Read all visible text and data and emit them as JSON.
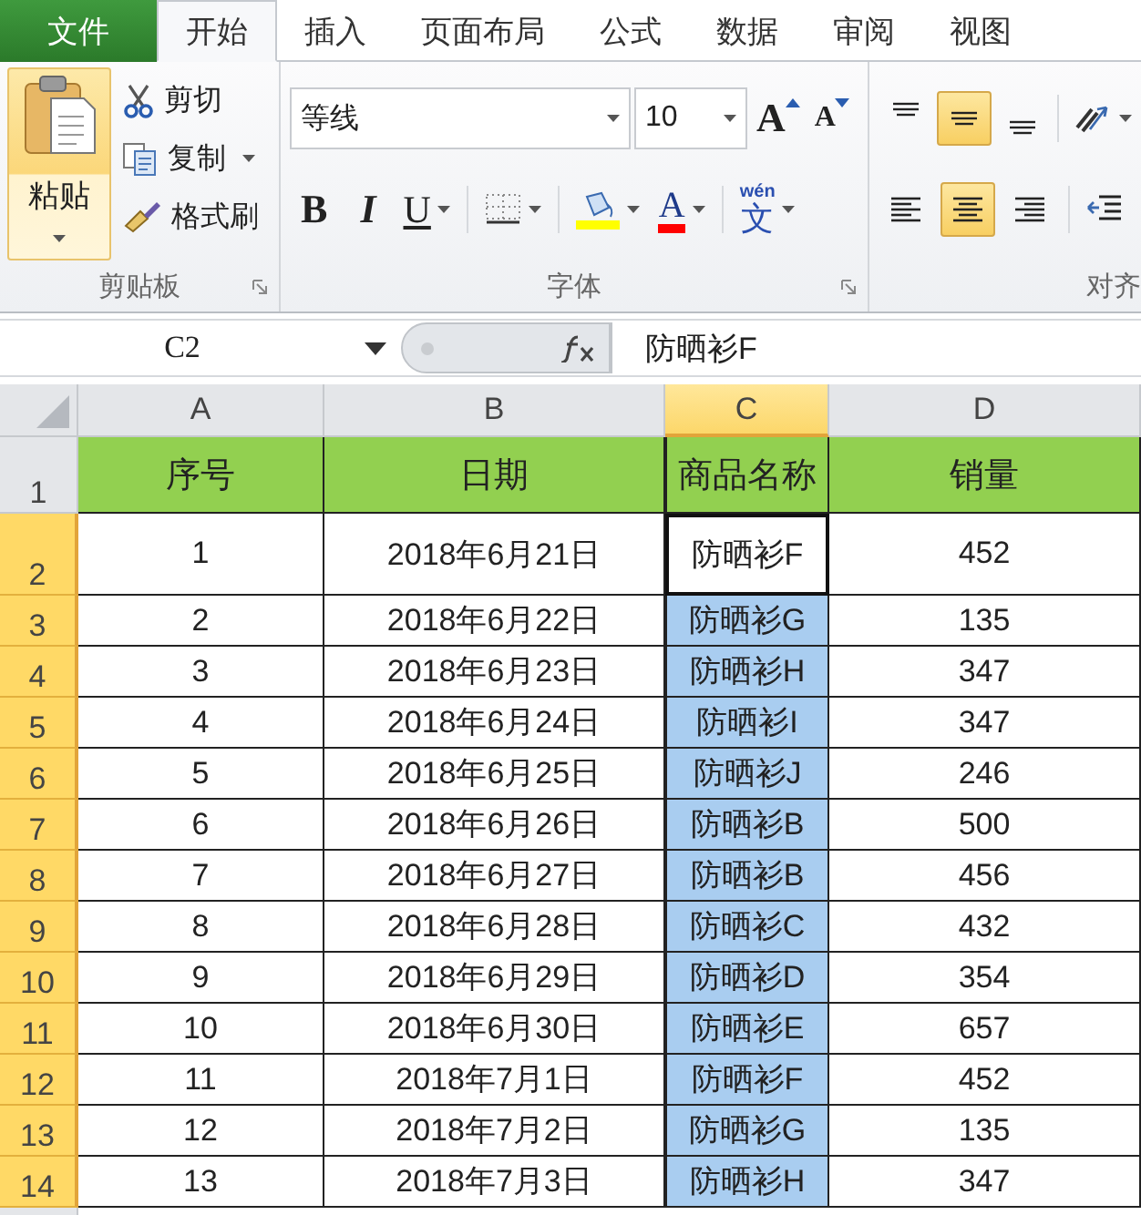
{
  "tabs": [
    {
      "label": "文件",
      "kind": "file",
      "selected": false
    },
    {
      "label": "开始",
      "kind": "tab",
      "selected": true
    },
    {
      "label": "插入",
      "kind": "tab",
      "selected": false
    },
    {
      "label": "页面布局",
      "kind": "tab",
      "selected": false
    },
    {
      "label": "公式",
      "kind": "tab",
      "selected": false
    },
    {
      "label": "数据",
      "kind": "tab",
      "selected": false
    },
    {
      "label": "审阅",
      "kind": "tab",
      "selected": false
    },
    {
      "label": "视图",
      "kind": "tab",
      "selected": false
    }
  ],
  "clipboard": {
    "paste": "粘贴",
    "cut": "剪切",
    "copy": "复制",
    "format_painter": "格式刷",
    "label": "剪贴板"
  },
  "font": {
    "name": "等线",
    "size": "10",
    "grow": "A",
    "shrink": "A",
    "bold": "B",
    "italic": "I",
    "underline": "U",
    "font_color": "A",
    "phonetic_top": "wén",
    "phonetic_main": "文",
    "label": "字体"
  },
  "alignment": {
    "label": "对齐",
    "vertical": [
      {
        "kind": "top",
        "selected": false
      },
      {
        "kind": "middle",
        "selected": true
      },
      {
        "kind": "bottom",
        "selected": false
      }
    ],
    "horizontal": [
      {
        "kind": "left",
        "selected": false
      },
      {
        "kind": "center",
        "selected": true
      },
      {
        "kind": "right",
        "selected": false
      }
    ]
  },
  "formula_bar": {
    "name_box": "C2",
    "value": "防晒衫F"
  },
  "columns": [
    {
      "label": "A",
      "selected": false
    },
    {
      "label": "B",
      "selected": false
    },
    {
      "label": "C",
      "selected": true
    },
    {
      "label": "D",
      "selected": false
    }
  ],
  "rows": [
    {
      "number": "1",
      "kind": "header",
      "selected": false,
      "active": false,
      "cells": [
        "序号",
        "日期",
        "商品名称",
        "销量"
      ]
    },
    {
      "number": "2",
      "kind": "data",
      "selected": true,
      "active": true,
      "cells": [
        "1",
        "2018年6月21日",
        "防晒衫F",
        "452"
      ]
    },
    {
      "number": "3",
      "kind": "data",
      "selected": true,
      "active": false,
      "cells": [
        "2",
        "2018年6月22日",
        "防晒衫G",
        "135"
      ]
    },
    {
      "number": "4",
      "kind": "data",
      "selected": true,
      "active": false,
      "cells": [
        "3",
        "2018年6月23日",
        "防晒衫H",
        "347"
      ]
    },
    {
      "number": "5",
      "kind": "data",
      "selected": true,
      "active": false,
      "cells": [
        "4",
        "2018年6月24日",
        "防晒衫I",
        "347"
      ]
    },
    {
      "number": "6",
      "kind": "data",
      "selected": true,
      "active": false,
      "cells": [
        "5",
        "2018年6月25日",
        "防晒衫J",
        "246"
      ]
    },
    {
      "number": "7",
      "kind": "data",
      "selected": true,
      "active": false,
      "cells": [
        "6",
        "2018年6月26日",
        "防晒衫B",
        "500"
      ]
    },
    {
      "number": "8",
      "kind": "data",
      "selected": true,
      "active": false,
      "cells": [
        "7",
        "2018年6月27日",
        "防晒衫B",
        "456"
      ]
    },
    {
      "number": "9",
      "kind": "data",
      "selected": true,
      "active": false,
      "cells": [
        "8",
        "2018年6月28日",
        "防晒衫C",
        "432"
      ]
    },
    {
      "number": "10",
      "kind": "data",
      "selected": true,
      "active": false,
      "cells": [
        "9",
        "2018年6月29日",
        "防晒衫D",
        "354"
      ]
    },
    {
      "number": "11",
      "kind": "data",
      "selected": true,
      "active": false,
      "cells": [
        "10",
        "2018年6月30日",
        "防晒衫E",
        "657"
      ]
    },
    {
      "number": "12",
      "kind": "data",
      "selected": true,
      "active": false,
      "cells": [
        "11",
        "2018年7月1日",
        "防晒衫F",
        "452"
      ]
    },
    {
      "number": "13",
      "kind": "data",
      "selected": true,
      "active": false,
      "cells": [
        "12",
        "2018年7月2日",
        "防晒衫G",
        "135"
      ]
    },
    {
      "number": "14",
      "kind": "data",
      "selected": true,
      "active": false,
      "cells": [
        "13",
        "2018年7月3日",
        "防晒衫H",
        "347"
      ]
    }
  ]
}
